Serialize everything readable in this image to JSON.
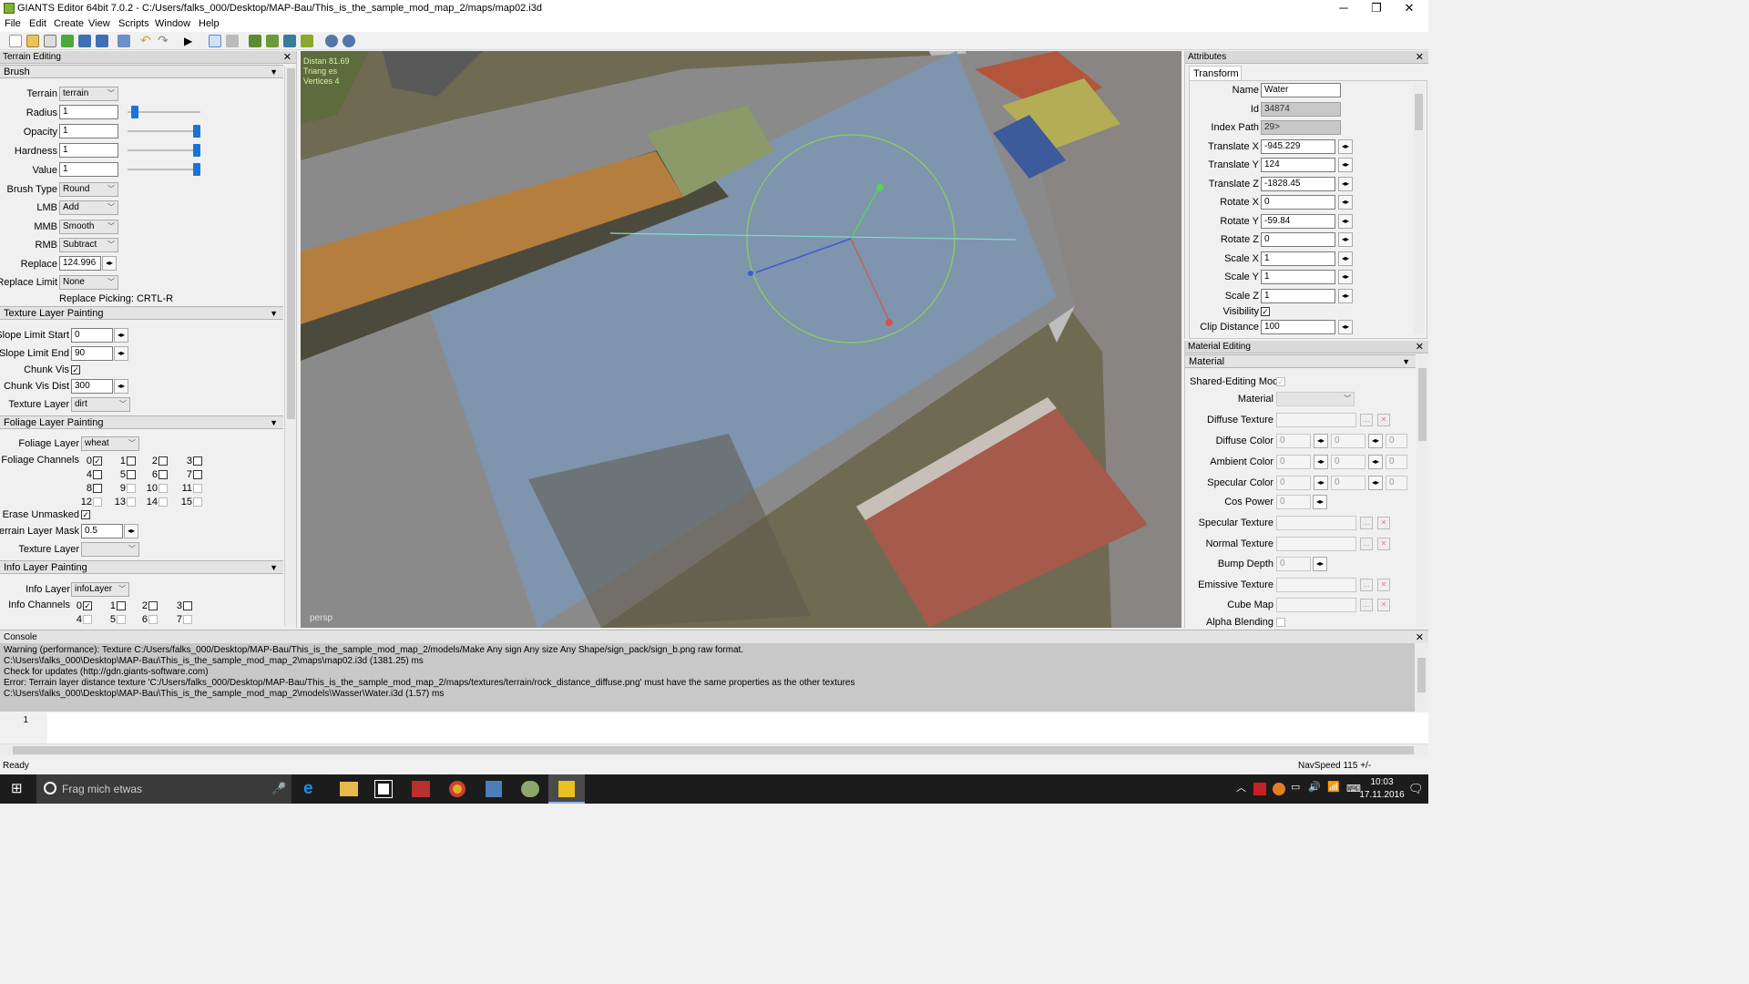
{
  "window": {
    "title": "GIANTS Editor 64bit 7.0.2 - C:/Users/falks_000/Desktop/MAP-Bau/This_is_the_sample_mod_map_2/maps/map02.i3d",
    "min": "─",
    "max": "❐",
    "close": "✕"
  },
  "menu": [
    "File",
    "Edit",
    "Create",
    "View",
    "Scripts",
    "Window",
    "Help"
  ],
  "terrain_panel": {
    "title": "Terrain Editing",
    "brush": {
      "header": "Brush",
      "terrain_label": "Terrain",
      "terrain_value": "terrain",
      "radius_label": "Radius",
      "radius_value": "1",
      "radius_level": 0.05,
      "opacity_label": "Opacity",
      "opacity_value": "1",
      "opacity_level": 1,
      "hardness_label": "Hardness",
      "hardness_value": "1",
      "hardness_level": 1,
      "value_label": "Value",
      "value_value": "1",
      "value_level": 1,
      "brush_type_label": "Brush Type",
      "brush_type_value": "Round",
      "lmb_label": "LMB",
      "lmb_value": "Add",
      "mmb_label": "MMB",
      "mmb_value": "Smooth",
      "rmb_label": "RMB",
      "rmb_value": "Subtract",
      "replace_label": "Replace",
      "replace_value": "124.996",
      "replace_limit_label": "Replace Limit",
      "replace_limit_value": "None",
      "replace_picking": "Replace Picking: CRTL-R"
    },
    "texture": {
      "header": "Texture Layer Painting",
      "slope_start_label": "Slope Limit Start",
      "slope_start_value": "0",
      "slope_end_label": "Slope Limit End",
      "slope_end_value": "90",
      "chunk_vis_label": "Chunk Vis",
      "chunk_vis_dist_label": "Chunk Vis Dist",
      "chunk_vis_dist_value": "300",
      "texture_layer_label": "Texture Layer",
      "texture_layer_value": "dirt"
    },
    "foliage": {
      "header": "Foliage Layer Painting",
      "foliage_layer_label": "Foliage Layer",
      "foliage_layer_value": "wheat",
      "channels_label": "Foliage Channels",
      "channels": [
        "0",
        "1",
        "2",
        "3",
        "4",
        "5",
        "6",
        "7",
        "8",
        "9",
        "10",
        "11",
        "12",
        "13",
        "14",
        "15"
      ],
      "erase_unmasked_label": "Erase Unmasked",
      "terrain_mask_label": "Terrain Layer Mask",
      "terrain_mask_value": "0.5",
      "texture_layer_label": "Texture Layer",
      "texture_layer_value": ""
    },
    "info": {
      "header": "Info Layer Painting",
      "info_layer_label": "Info Layer",
      "info_layer_value": "infoLayer",
      "channels_label": "Info Channels",
      "channels": [
        "0",
        "1",
        "2",
        "3",
        "4",
        "5",
        "6",
        "7"
      ]
    }
  },
  "viewport": {
    "overlay_lines": [
      "Distan 81.69",
      "Triang es",
      "Vertices 4"
    ],
    "camera_label": "persp"
  },
  "attributes": {
    "title": "Attributes",
    "tab": "Transform",
    "fields": [
      {
        "label": "Name",
        "value": "Water",
        "ro": false,
        "spin": false
      },
      {
        "label": "Id",
        "value": "34874",
        "ro": true,
        "spin": false
      },
      {
        "label": "Index Path",
        "value": "29>",
        "ro": true,
        "spin": false
      },
      {
        "label": "Translate X",
        "value": "-945.229",
        "ro": false,
        "spin": true
      },
      {
        "label": "Translate Y",
        "value": "124",
        "ro": false,
        "spin": true
      },
      {
        "label": "Translate Z",
        "value": "-1828.45",
        "ro": false,
        "spin": true
      },
      {
        "label": "Rotate X",
        "value": "0",
        "ro": false,
        "spin": true
      },
      {
        "label": "Rotate Y",
        "value": "-59.84",
        "ro": false,
        "spin": true
      },
      {
        "label": "Rotate Z",
        "value": "0",
        "ro": false,
        "spin": true
      },
      {
        "label": "Scale X",
        "value": "1",
        "ro": false,
        "spin": true
      },
      {
        "label": "Scale Y",
        "value": "1",
        "ro": false,
        "spin": true
      },
      {
        "label": "Scale Z",
        "value": "1",
        "ro": false,
        "spin": true
      }
    ],
    "visibility_label": "Visibility",
    "clip_label": "Clip Distance",
    "clip_value": "100"
  },
  "material": {
    "title": "Material Editing",
    "header": "Material",
    "shared_label": "Shared-Editing Mode",
    "material_label": "Material",
    "diffuse_texture_label": "Diffuse Texture",
    "diffuse_color_label": "Diffuse Color",
    "ambient_color_label": "Ambient Color",
    "specular_color_label": "Specular Color",
    "color_value": "0",
    "cos_power_label": "Cos Power",
    "cos_power_value": "0",
    "specular_texture_label": "Specular Texture",
    "normal_texture_label": "Normal Texture",
    "bump_depth_label": "Bump Depth",
    "bump_depth_value": "0",
    "emissive_texture_label": "Emissive Texture",
    "cube_map_label": "Cube Map",
    "alpha_blending_label": "Alpha Blending",
    "dots": "..."
  },
  "console": {
    "title": "Console",
    "lines": [
      "Warning (performance): Texture C:/Users/falks_000/Desktop/MAP-Bau/This_is_the_sample_mod_map_2/models/Make Any sign Any size Any Shape/sign_pack/sign_b.png raw format.",
      "C:\\Users\\falks_000\\Desktop\\MAP-Bau\\This_is_the_sample_mod_map_2\\maps\\map02.i3d (1381.25) ms",
      "Check for updates (http://gdn.giants-software.com)",
      "Error: Terrain layer distance texture 'C:/Users/falks_000/Desktop/MAP-Bau/This_is_the_sample_mod_map_2/maps/textures/terrain/rock_distance_diffuse.png' must have the same properties as the other textures",
      "C:\\Users\\falks_000\\Desktop\\MAP-Bau\\This_is_the_sample_mod_map_2\\models\\Wasser\\Water.i3d (1.57) ms"
    ],
    "line_number": "1"
  },
  "status": {
    "left": "Ready",
    "right": "NavSpeed 115 +/-"
  },
  "taskbar": {
    "search_placeholder": "Frag mich etwas",
    "time": "10:03",
    "date": "17.11.2016"
  }
}
